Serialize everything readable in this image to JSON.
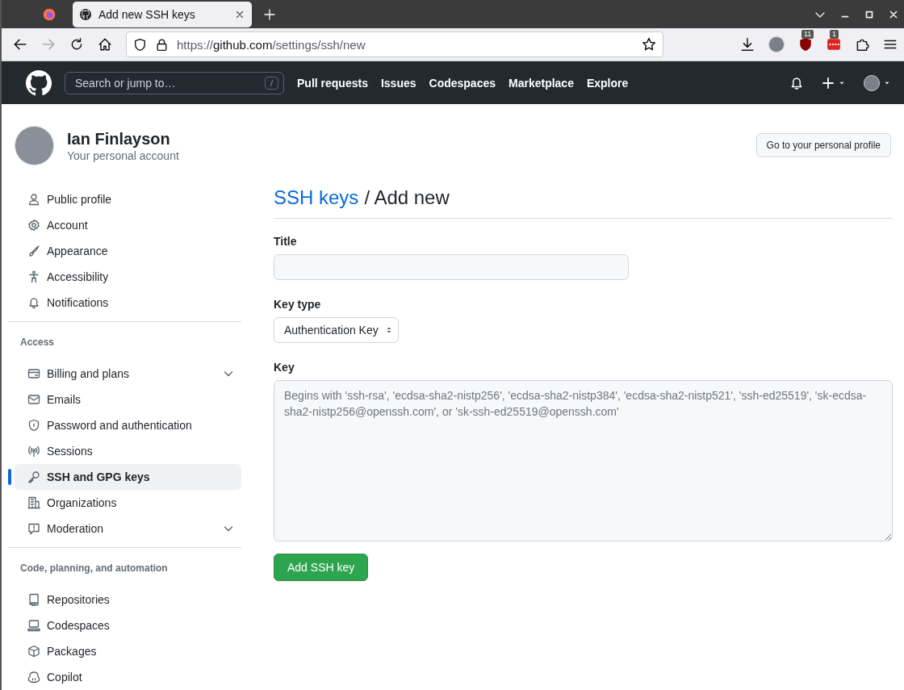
{
  "browser": {
    "tab_title": "Add new SSH keys",
    "url": {
      "scheme": "https://",
      "host": "github.com",
      "path": "/settings/ssh/new"
    },
    "extension_badges": [
      "11",
      "1"
    ]
  },
  "header": {
    "search": {
      "placeholder": "Search or jump to…",
      "shortcut": "/"
    },
    "nav": [
      "Pull requests",
      "Issues",
      "Codespaces",
      "Marketplace",
      "Explore"
    ]
  },
  "profile": {
    "name": "Ian Finlayson",
    "subtitle": "Your personal account",
    "button": "Go to your personal profile"
  },
  "sidebar": [
    {
      "items": [
        {
          "label": "Public profile",
          "kind": "person",
          "selected": false,
          "expandable": false
        },
        {
          "label": "Account",
          "kind": "gear",
          "selected": false,
          "expandable": false
        },
        {
          "label": "Appearance",
          "kind": "brush",
          "selected": false,
          "expandable": false
        },
        {
          "label": "Accessibility",
          "kind": "figure",
          "selected": false,
          "expandable": false
        },
        {
          "label": "Notifications",
          "kind": "bell",
          "selected": false,
          "expandable": false
        }
      ]
    },
    {
      "heading": "Access",
      "items": [
        {
          "label": "Billing and plans",
          "kind": "card",
          "selected": false,
          "expandable": true
        },
        {
          "label": "Emails",
          "kind": "mail",
          "selected": false,
          "expandable": false
        },
        {
          "label": "Password and authentication",
          "kind": "shield",
          "selected": false,
          "expandable": false
        },
        {
          "label": "Sessions",
          "kind": "broadcast",
          "selected": false,
          "expandable": false
        },
        {
          "label": "SSH and GPG keys",
          "kind": "key",
          "selected": true,
          "expandable": false
        },
        {
          "label": "Organizations",
          "kind": "building",
          "selected": false,
          "expandable": false
        },
        {
          "label": "Moderation",
          "kind": "report",
          "selected": false,
          "expandable": true
        }
      ]
    },
    {
      "heading": "Code, planning, and automation",
      "items": [
        {
          "label": "Repositories",
          "kind": "repo",
          "selected": false,
          "expandable": false
        },
        {
          "label": "Codespaces",
          "kind": "laptop",
          "selected": false,
          "expandable": false
        },
        {
          "label": "Packages",
          "kind": "package",
          "selected": false,
          "expandable": false
        },
        {
          "label": "Copilot",
          "kind": "copilot",
          "selected": false,
          "expandable": false
        }
      ]
    }
  ],
  "page": {
    "breadcrumb_link": "SSH keys",
    "breadcrumb_rest": "/ Add new",
    "form": {
      "title_label": "Title",
      "key_type_label": "Key type",
      "key_type_value": "Authentication Key",
      "key_label": "Key",
      "key_placeholder": "Begins with 'ssh-rsa', 'ecdsa-sha2-nistp256', 'ecdsa-sha2-nistp384', 'ecdsa-sha2-nistp521', 'ssh-ed25519', 'sk-ecdsa-sha2-nistp256@openssh.com', or 'sk-ssh-ed25519@openssh.com'",
      "submit": "Add SSH key"
    }
  }
}
